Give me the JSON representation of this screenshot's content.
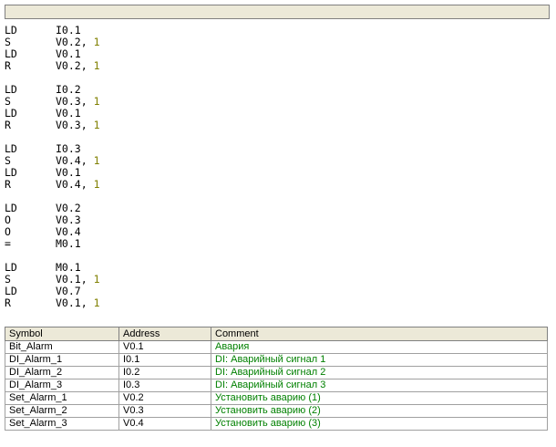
{
  "program": {
    "networks": [
      [
        {
          "op": "LD",
          "operand": "I0.1",
          "param": ""
        },
        {
          "op": "S",
          "operand": "V0.2,",
          "param": "1"
        },
        {
          "op": "LD",
          "operand": "V0.1",
          "param": ""
        },
        {
          "op": "R",
          "operand": "V0.2,",
          "param": "1"
        }
      ],
      [
        {
          "op": "LD",
          "operand": "I0.2",
          "param": ""
        },
        {
          "op": "S",
          "operand": "V0.3,",
          "param": "1"
        },
        {
          "op": "LD",
          "operand": "V0.1",
          "param": ""
        },
        {
          "op": "R",
          "operand": "V0.3,",
          "param": "1"
        }
      ],
      [
        {
          "op": "LD",
          "operand": "I0.3",
          "param": ""
        },
        {
          "op": "S",
          "operand": "V0.4,",
          "param": "1"
        },
        {
          "op": "LD",
          "operand": "V0.1",
          "param": ""
        },
        {
          "op": "R",
          "operand": "V0.4,",
          "param": "1"
        }
      ],
      [
        {
          "op": "LD",
          "operand": "V0.2",
          "param": ""
        },
        {
          "op": "O",
          "operand": "V0.3",
          "param": ""
        },
        {
          "op": "O",
          "operand": "V0.4",
          "param": ""
        },
        {
          "op": "=",
          "operand": "M0.1",
          "param": ""
        }
      ],
      [
        {
          "op": "LD",
          "operand": "M0.1",
          "param": ""
        },
        {
          "op": "S",
          "operand": "V0.1,",
          "param": "1"
        },
        {
          "op": "LD",
          "operand": "V0.7",
          "param": ""
        },
        {
          "op": "R",
          "operand": "V0.1,",
          "param": "1"
        }
      ]
    ]
  },
  "symbol_table": {
    "headers": {
      "symbol": "Symbol",
      "address": "Address",
      "comment": "Comment"
    },
    "rows": [
      {
        "symbol": "Bit_Alarm",
        "address": "V0.1",
        "comment": "Авария"
      },
      {
        "symbol": "DI_Alarm_1",
        "address": "I0.1",
        "comment": "DI: Аварийный сигнал 1"
      },
      {
        "symbol": "DI_Alarm_2",
        "address": "I0.2",
        "comment": "DI: Аварийный сигнал 2"
      },
      {
        "symbol": "DI_Alarm_3",
        "address": "I0.3",
        "comment": "DI: Аварийный сигнал 3"
      },
      {
        "symbol": "Set_Alarm_1",
        "address": "V0.2",
        "comment": "Установить аварию (1)"
      },
      {
        "symbol": "Set_Alarm_2",
        "address": "V0.3",
        "comment": "Установить аварию (2)"
      },
      {
        "symbol": "Set_Alarm_3",
        "address": "V0.4",
        "comment": "Установить аварию (3)"
      }
    ]
  },
  "colors": {
    "comment_text": "#008000",
    "numeric_param": "#808000",
    "header_bg": "#ece9d8"
  }
}
